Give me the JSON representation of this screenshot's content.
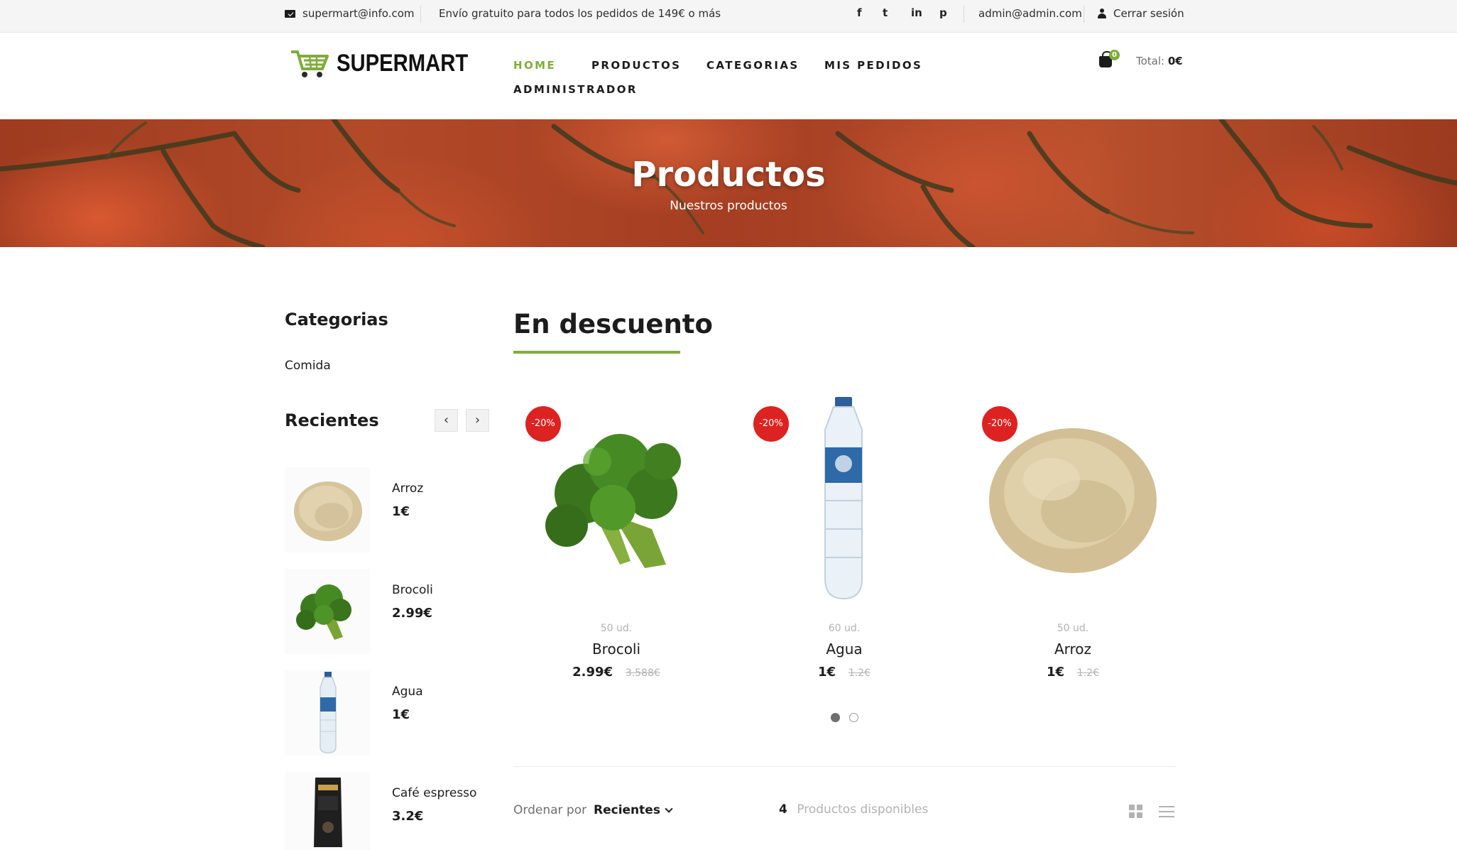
{
  "topbar": {
    "email": "supermart@info.com",
    "shipping": "Envío gratuito para todos los pedidos de 149€ o más",
    "social": [
      "f",
      "t",
      "in",
      "p"
    ],
    "admin_email": "admin@admin.com",
    "logout": "Cerrar sesión"
  },
  "header": {
    "logo": "SUPERMART",
    "nav": [
      "HOME",
      "PRODUCTOS",
      "CATEGORIAS",
      "MIS PEDIDOS",
      "ADMINISTRADOR"
    ],
    "cart_count": "0",
    "total_label": "Total:",
    "total_value": "0€"
  },
  "banner": {
    "title": "Productos",
    "subtitle": "Nuestros productos"
  },
  "sidebar": {
    "categories_title": "Categorias",
    "categories": [
      "Comida"
    ],
    "recent_title": "Recientes",
    "recent": [
      {
        "name": "Arroz",
        "price": "1€"
      },
      {
        "name": "Brocoli",
        "price": "2.99€"
      },
      {
        "name": "Agua",
        "price": "1€"
      },
      {
        "name": "Café espresso",
        "price": "3.2€"
      }
    ]
  },
  "main": {
    "title": "En descuento",
    "discounted": [
      {
        "badge": "-20%",
        "units": "50 ud.",
        "name": "Brocoli",
        "price": "2.99€",
        "old_price": "3.588€"
      },
      {
        "badge": "-20%",
        "units": "60 ud.",
        "name": "Agua",
        "price": "1€",
        "old_price": "1.2€"
      },
      {
        "badge": "-20%",
        "units": "50 ud.",
        "name": "Arroz",
        "price": "1€",
        "old_price": "1.2€"
      }
    ],
    "sort_label": "Ordenar por",
    "sort_value": "Recientes",
    "found_count": "4",
    "found_label": "Productos disponibles"
  },
  "colors": {
    "accent": "#7fad39",
    "badge": "#dd2222",
    "text": "#1c1c1c",
    "muted": "#b2b2b2"
  }
}
